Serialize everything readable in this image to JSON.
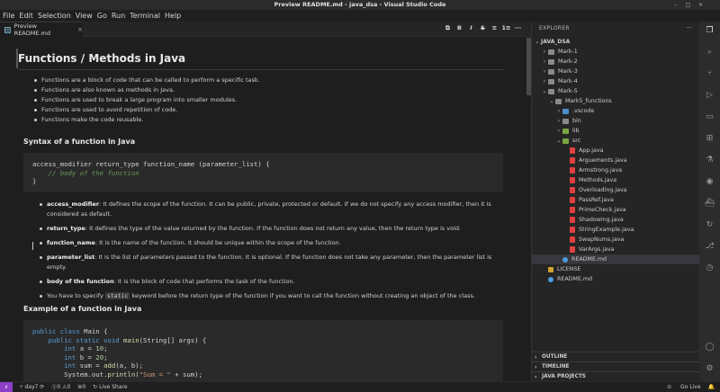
{
  "window": {
    "title": "Preview README.md - java_dsa - Visual Studio Code"
  },
  "menu": [
    "File",
    "Edit",
    "Selection",
    "View",
    "Go",
    "Run",
    "Terminal",
    "Help"
  ],
  "tab": {
    "label": "Preview README.md",
    "close": "×"
  },
  "format_tools": [
    "B",
    "I",
    "S",
    "≡",
    "1≡"
  ],
  "doc": {
    "h1": "Functions / Methods in Java",
    "intro_bullets": [
      "Functions are a block of code that can be called to perform a specific task.",
      "Functions are also known as methods in Java.",
      "Functions are used to break a large program into smaller modules.",
      "Functions are used to avoid repetition of code.",
      "Functions make the code reusable."
    ],
    "h2_syntax": "Syntax of a function in Java",
    "syntax_code": {
      "line1": "access_modifier return_type function_name (parameter_list) {",
      "line2": "    // body of the function",
      "line3": "}"
    },
    "params": [
      {
        "term": "access_modifier",
        "desc": ": It defines the scope of the function. It can be public, private, protected or default. If we do not specify any access modifier, then it is considered as default."
      },
      {
        "term": "return_type",
        "desc": ": It defines the type of the value returned by the function. If the function does not return any value, then the return type is void."
      },
      {
        "term": "function_name",
        "desc": ": It is the name of the function. It should be unique within the scope of the function."
      },
      {
        "term": "parameter_list",
        "desc": ": It is the list of parameters passed to the function. It is optional. If the function does not take any parameter, then the parameter list is empty."
      },
      {
        "term": "body of the function",
        "desc": ": It is the block of code that performs the task of the function."
      }
    ],
    "static_note": {
      "before": "You have to specify ",
      "code": "static",
      "after": " keyword before the return type of the function if you want to call the function without creating an object of the class."
    },
    "h2_example": "Example of a function in Java",
    "example_code": {
      "l1_kw": "public class",
      "l1_rest": " Main {",
      "l2_kw": "    public static void",
      "l2_fn": " main",
      "l2_rest": "(String[] args) {",
      "l3_kw": "        int",
      "l3_rest": " a = ",
      "l3_num": "10",
      "l3_end": ";",
      "l4_kw": "        int",
      "l4_rest": " b = ",
      "l4_num": "20",
      "l4_end": ";",
      "l5_kw": "        int",
      "l5_rest": " sum = ",
      "l5_fn": "add",
      "l5_end": "(a, b);",
      "l6_pre": "        System.out.",
      "l6_fn": "println",
      "l6_open": "(",
      "l6_str": "\"Sum = \"",
      "l6_end": " + sum);"
    }
  },
  "explorer": {
    "header": "EXPLORER",
    "more": "···",
    "root": "JAVA_DSA",
    "tree": [
      {
        "label": "Mark-1",
        "depth": 1,
        "chev": "›",
        "icon": "folder"
      },
      {
        "label": "Mark-2",
        "depth": 1,
        "chev": "›",
        "icon": "folder"
      },
      {
        "label": "Mark-3",
        "depth": 1,
        "chev": "›",
        "icon": "folder"
      },
      {
        "label": "Mark-4",
        "depth": 1,
        "chev": "›",
        "icon": "folder"
      },
      {
        "label": "Mark-5",
        "depth": 1,
        "chev": "⌄",
        "icon": "folder"
      },
      {
        "label": "Mark5_functions",
        "depth": 2,
        "chev": "⌄",
        "icon": "folder"
      },
      {
        "label": ".vscode",
        "depth": 3,
        "chev": "›",
        "icon": "folder-blue"
      },
      {
        "label": "bin",
        "depth": 3,
        "chev": "›",
        "icon": "folder"
      },
      {
        "label": "lib",
        "depth": 3,
        "chev": "›",
        "icon": "folder-green"
      },
      {
        "label": "src",
        "depth": 3,
        "chev": "⌄",
        "icon": "folder-green"
      },
      {
        "label": "App.java",
        "depth": 4,
        "chev": "",
        "icon": "java"
      },
      {
        "label": "Arguements.java",
        "depth": 4,
        "chev": "",
        "icon": "java"
      },
      {
        "label": "Armstrong.java",
        "depth": 4,
        "chev": "",
        "icon": "java"
      },
      {
        "label": "Methods.java",
        "depth": 4,
        "chev": "",
        "icon": "java"
      },
      {
        "label": "Overloading.java",
        "depth": 4,
        "chev": "",
        "icon": "java"
      },
      {
        "label": "PassRef.java",
        "depth": 4,
        "chev": "",
        "icon": "java"
      },
      {
        "label": "PrimeCheck.java",
        "depth": 4,
        "chev": "",
        "icon": "java"
      },
      {
        "label": "Shadowing.java",
        "depth": 4,
        "chev": "",
        "icon": "java"
      },
      {
        "label": "StringExample.java",
        "depth": 4,
        "chev": "",
        "icon": "java"
      },
      {
        "label": "SwapNums.java",
        "depth": 4,
        "chev": "",
        "icon": "java"
      },
      {
        "label": "VarArgs.java",
        "depth": 4,
        "chev": "",
        "icon": "java"
      },
      {
        "label": "README.md",
        "depth": 3,
        "chev": "",
        "icon": "info",
        "selected": true
      },
      {
        "label": "LICENSE",
        "depth": 1,
        "chev": "",
        "icon": "license"
      },
      {
        "label": "README.md",
        "depth": 1,
        "chev": "",
        "icon": "info"
      }
    ],
    "sections": [
      "OUTLINE",
      "TIMELINE",
      "JAVA PROJECTS"
    ]
  },
  "status": {
    "branch": "day7",
    "errors": "0",
    "warnings": "0",
    "ports": "0",
    "live_share": "Live Share",
    "go_live": "Go Live"
  }
}
